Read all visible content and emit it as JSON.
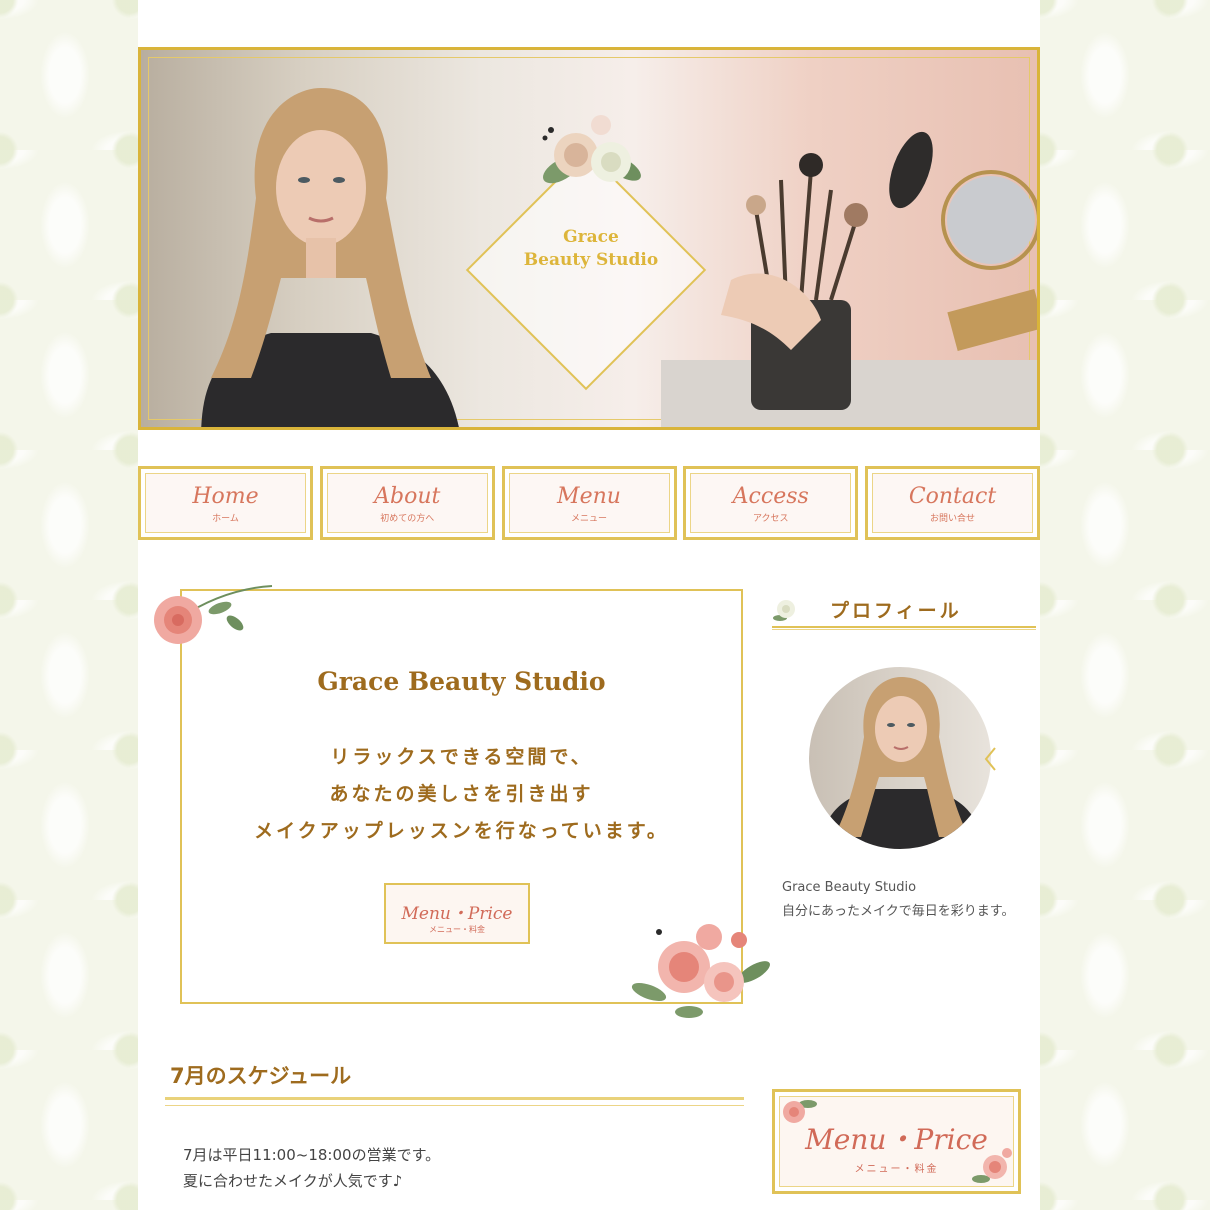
{
  "hero": {
    "logo_line1": "Grace",
    "logo_line2": "Beauty Studio"
  },
  "nav": [
    {
      "en": "Home",
      "ja": "ホーム"
    },
    {
      "en": "About",
      "ja": "初めての方へ"
    },
    {
      "en": "Menu",
      "ja": "メニュー"
    },
    {
      "en": "Access",
      "ja": "アクセス"
    },
    {
      "en": "Contact",
      "ja": "お問い合せ"
    }
  ],
  "intro": {
    "title": "Grace Beauty Studio",
    "lines": [
      "リラックスできる空間で、",
      "あなたの美しさを引き出す",
      "メイクアップレッスンを行なっています。"
    ],
    "button_en": "Menu・Price",
    "button_ja": "メニュー・料金"
  },
  "sidebar": {
    "profile_heading": "プロフィール",
    "profile_name": "Grace Beauty Studio",
    "profile_desc": "自分にあったメイクで毎日を彩ります。",
    "menu_banner_en": "Menu・Price",
    "menu_banner_ja": "メニュー・料金"
  },
  "schedule": {
    "title": "7月のスケジュール",
    "line1": "7月は平日11:00~18:00の営業です。",
    "line2": "夏に合わせたメイクが人気です♪"
  },
  "colors": {
    "gold": "#e0c257",
    "brown": "#9e6b1e",
    "rose": "#d16a58"
  }
}
